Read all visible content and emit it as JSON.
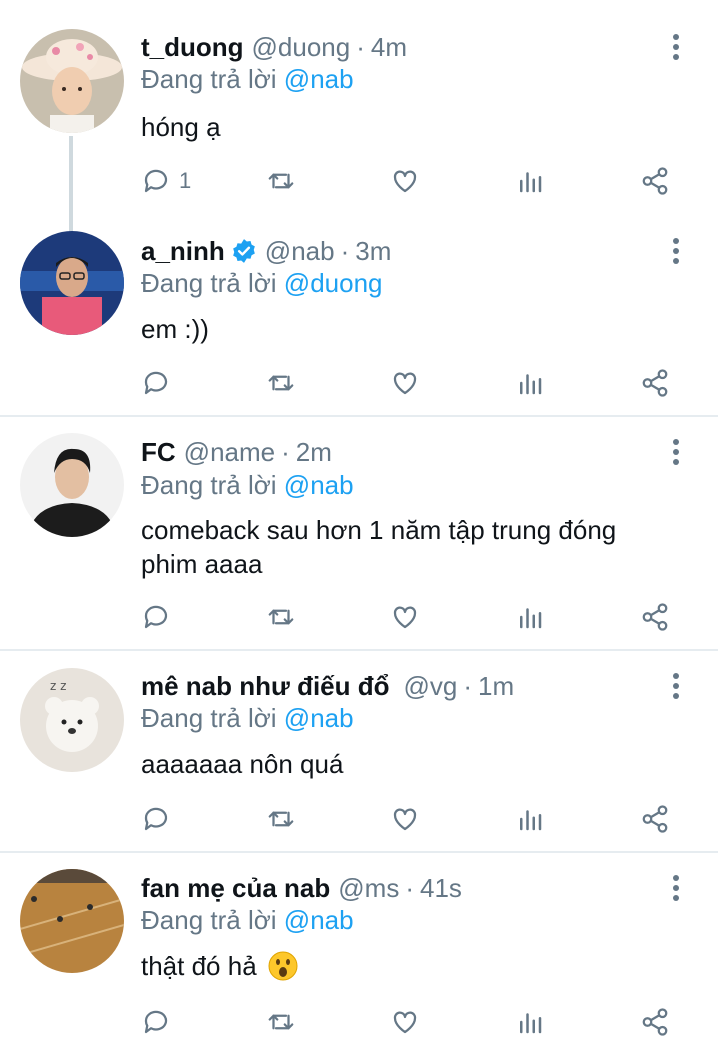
{
  "reply_prefix": "Đang trả lời",
  "tweets": [
    {
      "name": "t_duong",
      "verified": false,
      "handle": "@duong",
      "time": "4m",
      "reply_to": "@nab",
      "text": "hóng ạ",
      "reply_count": "1"
    },
    {
      "name": "a_ninh",
      "verified": true,
      "handle": "@nab",
      "time": "3m",
      "reply_to": "@duong",
      "text": "em :))",
      "reply_count": ""
    },
    {
      "name": "FC",
      "verified": false,
      "handle": "@name",
      "time": "2m",
      "reply_to": "@nab",
      "text": "comeback sau hơn 1 năm tập trung đóng phim aaaa",
      "reply_count": ""
    },
    {
      "name": "mê nab như điếu đổ",
      "verified": false,
      "handle": "@vg",
      "time": "1m",
      "reply_to": "@nab",
      "text": "aaaaaaa nôn quá",
      "reply_count": ""
    },
    {
      "name": "fan mẹ của nab",
      "verified": false,
      "handle": "@ms",
      "time": "41s",
      "reply_to": "@nab",
      "text": "thật đó hả",
      "text_emoji": "astonished-face",
      "reply_count": ""
    }
  ],
  "icons": {
    "reply": "reply-icon",
    "retweet": "retweet-icon",
    "like": "heart-icon",
    "stats": "stats-icon",
    "share": "share-icon",
    "more": "more-vertical-icon",
    "verified": "verified-badge-icon"
  },
  "colors": {
    "accent": "#1da1f2",
    "muted": "#657786",
    "text": "#0f1419",
    "divider": "#e6ecf0"
  }
}
